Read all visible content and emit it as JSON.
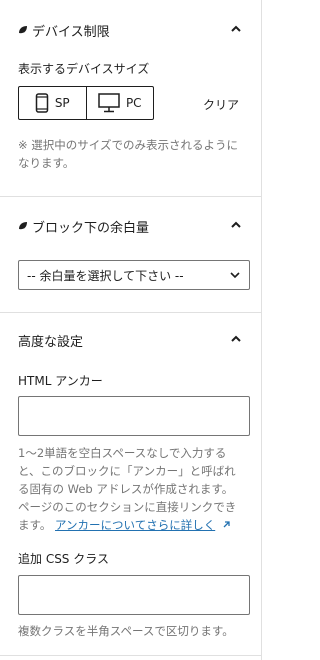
{
  "device_section": {
    "title": "デバイス制限",
    "label": "表示するデバイスサイズ",
    "buttons": {
      "sp": "SP",
      "pc": "PC",
      "clear": "クリア"
    },
    "help_line1": "※ 選択中のサイズでのみ表示されるように",
    "help_line2": "なります。"
  },
  "margin_section": {
    "title": "ブロック下の余白量",
    "select_value": "-- 余白量を選択して下さい --"
  },
  "advanced_section": {
    "title": "高度な設定",
    "anchor_label": "HTML アンカー",
    "anchor_value": "",
    "anchor_help_line1": "1〜2単語を空白スペースなしで入力する",
    "anchor_help_line2": "と、このブロックに「アンカー」と呼ばれ",
    "anchor_help_line3": "る固有の Web アドレスが作成されます。",
    "anchor_help_line4_prefix": "ページのこのセクションに直接リンクでき",
    "anchor_help_line5_prefix": "ます。",
    "anchor_link": "アンカーについてさらに詳しく",
    "css_label": "追加 CSS クラス",
    "css_value": "",
    "css_help": "複数クラスを半角スペースで区切ります。"
  },
  "colors": {
    "link": "#2271b1",
    "border": "#757575",
    "muted": "#757575",
    "text": "#1e1e1e"
  }
}
